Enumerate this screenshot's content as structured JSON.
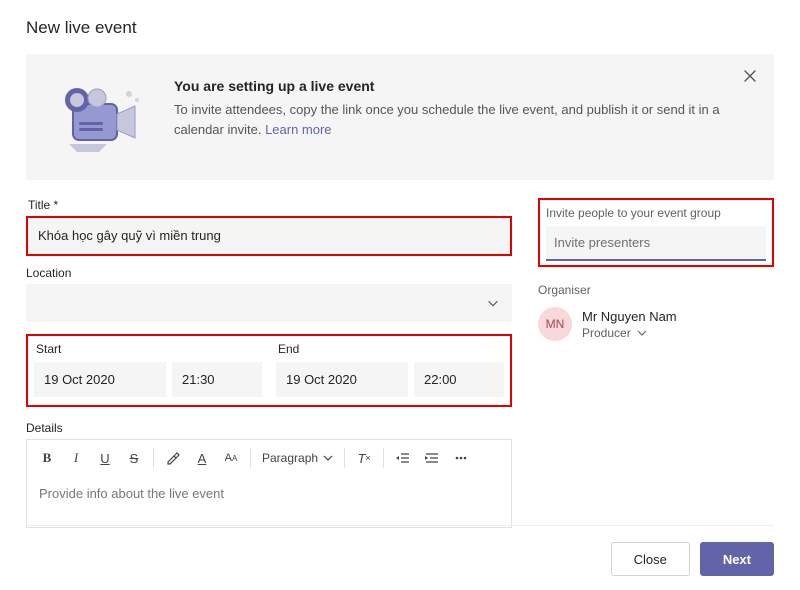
{
  "page_title": "New live event",
  "banner": {
    "title": "You are setting up a live event",
    "text_a": "To invite attendees, copy the link once you schedule the live event, and publish it or send it in a calendar invite. ",
    "learn_more": "Learn more"
  },
  "fields": {
    "title_label": "Title *",
    "title_value": "Khóa học gây quỹ vì miền trung",
    "location_label": "Location",
    "start_label": "Start",
    "start_date": "19 Oct 2020",
    "start_time": "21:30",
    "end_label": "End",
    "end_date": "19 Oct 2020",
    "end_time": "22:00",
    "details_label": "Details",
    "details_placeholder": "Provide info about the live event"
  },
  "toolbar": {
    "paragraph_label": "Paragraph"
  },
  "right": {
    "invite_label": "Invite people to your event group",
    "invite_placeholder": "Invite presenters",
    "organiser_label": "Organiser",
    "organiser_initials": "MN",
    "organiser_name": "Mr Nguyen Nam",
    "organiser_role": "Producer"
  },
  "footer": {
    "close": "Close",
    "next": "Next"
  }
}
